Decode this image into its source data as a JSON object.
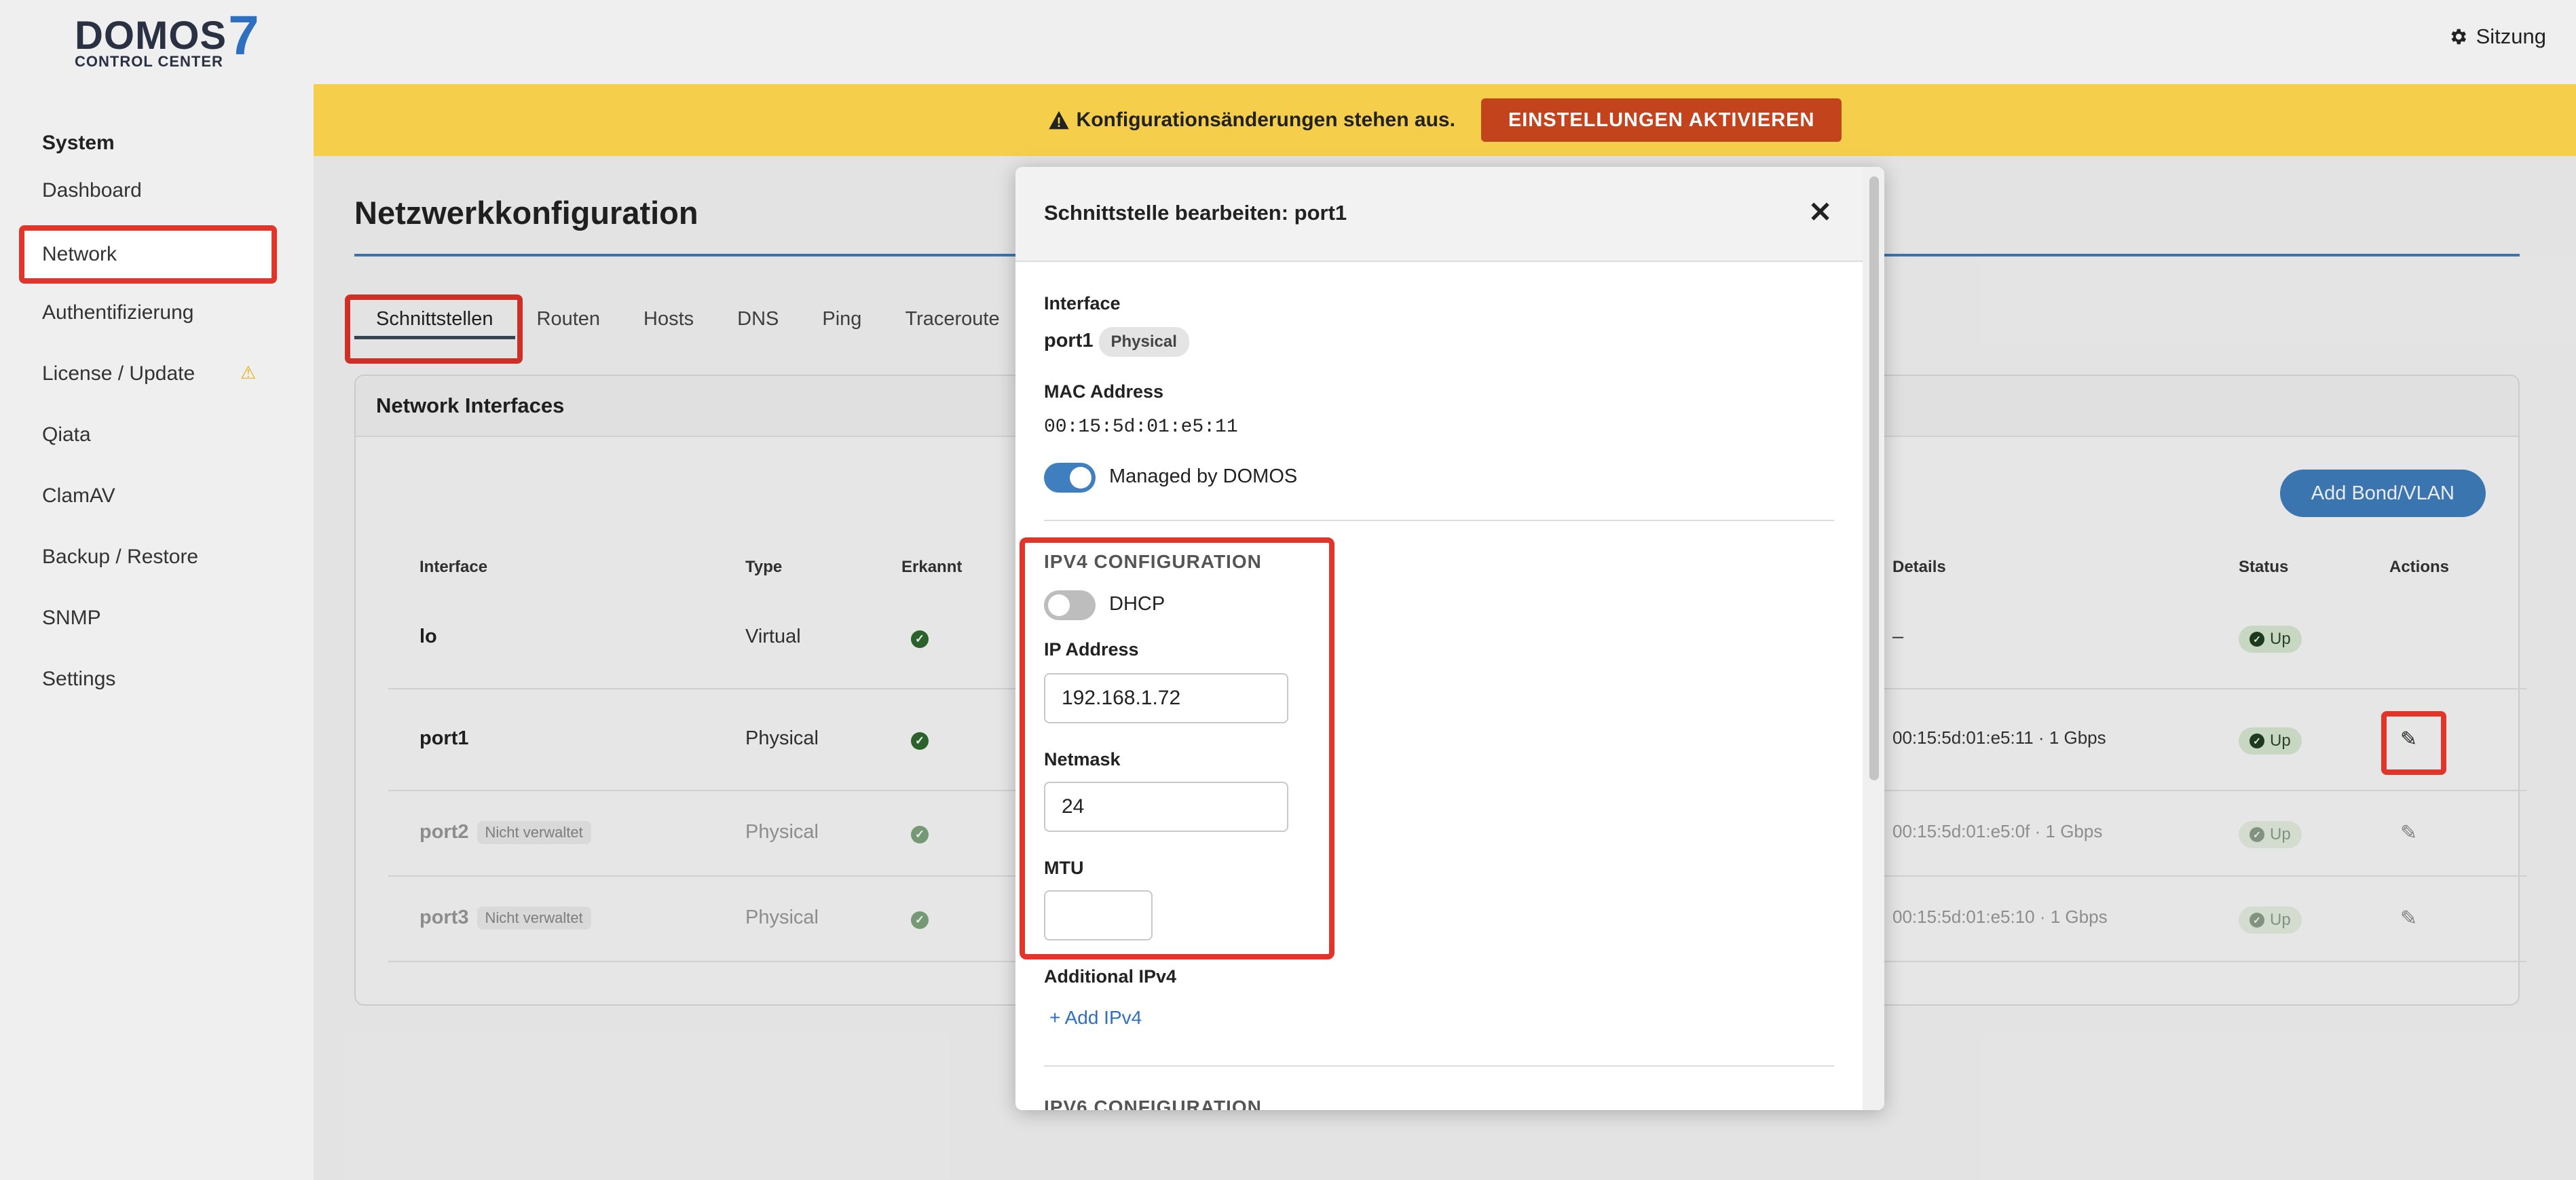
{
  "header": {
    "logo_main": "DOMOS",
    "logo_num": "7",
    "logo_sub": "CONTROL CENTER",
    "session_label": "Sitzung"
  },
  "sidebar": {
    "heading": "System",
    "items": [
      {
        "label": "Dashboard"
      },
      {
        "label": "Network"
      },
      {
        "label": "Authentifizierung"
      },
      {
        "label": "License / Update"
      },
      {
        "label": "Qiata"
      },
      {
        "label": "ClamAV"
      },
      {
        "label": "Backup / Restore"
      },
      {
        "label": "SNMP"
      },
      {
        "label": "Settings"
      }
    ]
  },
  "alert": {
    "message": "Konfigurationsänderungen stehen aus.",
    "button": "EINSTELLUNGEN AKTIVIEREN"
  },
  "page": {
    "title": "Netzwerkkonfiguration",
    "tabs": [
      "Schnittstellen",
      "Routen",
      "Hosts",
      "DNS",
      "Ping",
      "Traceroute"
    ]
  },
  "panel": {
    "title": "Network Interfaces",
    "add_button": "Add Bond/VLAN",
    "columns": {
      "interface": "Interface",
      "type": "Type",
      "erkannt": "Erkannt",
      "details": "Details",
      "status": "Status",
      "actions": "Actions"
    },
    "rows": [
      {
        "name": "lo",
        "tag": "",
        "type": "Virtual",
        "details": "–",
        "status": "Up"
      },
      {
        "name": "port1",
        "tag": "",
        "type": "Physical",
        "details": "00:15:5d:01:e5:11 · 1 Gbps",
        "status": "Up"
      },
      {
        "name": "port2",
        "tag": "Nicht verwaltet",
        "type": "Physical",
        "details": "00:15:5d:01:e5:0f · 1 Gbps",
        "status": "Up"
      },
      {
        "name": "port3",
        "tag": "Nicht verwaltet",
        "type": "Physical",
        "details": "00:15:5d:01:e5:10 · 1 Gbps",
        "status": "Up"
      }
    ]
  },
  "modal": {
    "title": "Schnittstelle bearbeiten: port1",
    "interface_label": "Interface",
    "interface_value": "port1",
    "interface_tag": "Physical",
    "mac_label": "MAC Address",
    "mac_value": "00:15:5d:01:e5:11",
    "managed_label": "Managed by DOMOS",
    "managed_on": true,
    "ipv4_title": "IPV4 CONFIGURATION",
    "dhcp_label": "DHCP",
    "dhcp_on": false,
    "ip_label": "IP Address",
    "ip_value": "192.168.1.72",
    "netmask_label": "Netmask",
    "netmask_value": "24",
    "mtu_label": "MTU",
    "mtu_value": "",
    "additional_label": "Additional IPv4",
    "add_ipv4_link": "+ Add IPv4",
    "ipv6_title": "IPV6 CONFIGURATION"
  },
  "colors": {
    "accent": "#3f7fbf",
    "alert_bg": "#f5cf4c",
    "alert_button": "#c2431c",
    "highlight": "#e0352b"
  }
}
